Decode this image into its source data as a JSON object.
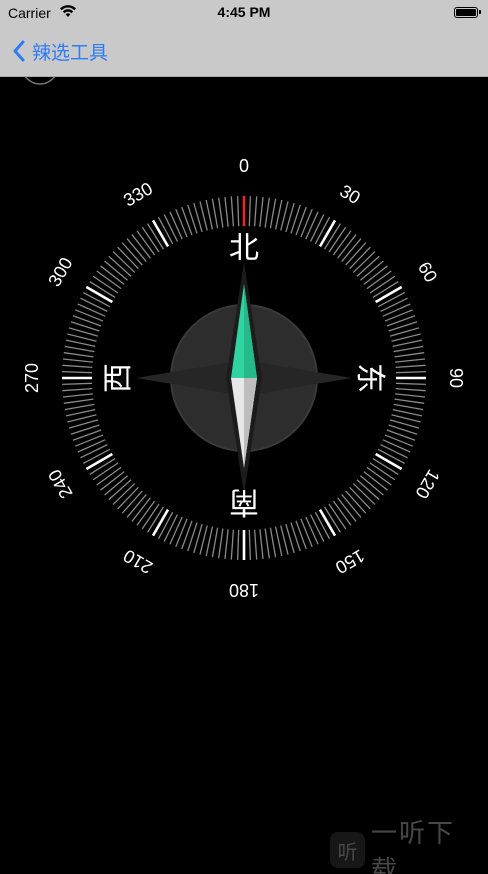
{
  "status_bar": {
    "carrier": "Carrier",
    "time": "4:45 PM",
    "wifi_icon": "wifi-icon",
    "battery_icon": "battery-icon"
  },
  "nav_bar": {
    "back_label": "辣选工具",
    "back_icon": "chevron-left-icon",
    "accent_color": "#2f7cf6"
  },
  "compass": {
    "heading_deg": 0,
    "degree_labels": [
      "0",
      "30",
      "60",
      "90",
      "120",
      "150",
      "180",
      "210",
      "240",
      "270",
      "300",
      "330"
    ],
    "directions": {
      "north": "北",
      "east": "东",
      "south": "南",
      "west": "西"
    },
    "needle_north_color": "#2fd4a0",
    "north_marker_color": "#e22b2b"
  },
  "watermark": {
    "logo_char": "听",
    "text": "一听下载"
  }
}
